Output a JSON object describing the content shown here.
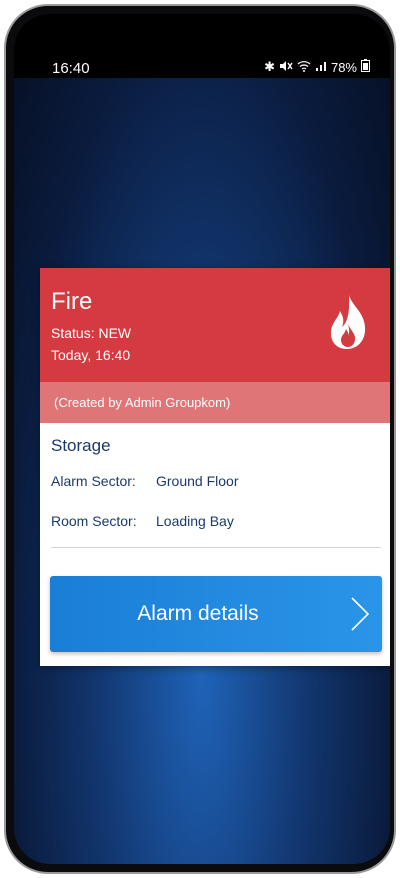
{
  "status_bar": {
    "time": "16:40",
    "icons": [
      "bluetooth-icon",
      "mute-icon",
      "wifi-icon",
      "signal-icon",
      "battery-icon"
    ],
    "battery": "78%"
  },
  "alarm": {
    "type": "Fire",
    "status": "Status: NEW",
    "time": "Today, 16:40",
    "icon": "fire-icon",
    "created_by": "(Created by Admin Groupkom)",
    "location": "Storage",
    "alarm_sector_label": "Alarm Sector:",
    "alarm_sector_value": "Ground Floor",
    "room_sector_label": "Room Sector:",
    "room_sector_value": "Loading Bay"
  },
  "details_button": {
    "label": "Alarm details",
    "icon": "chevron-right-icon"
  },
  "colors": {
    "header": "#d43b40",
    "created_bar": "#e07578",
    "button": "#2a95e8",
    "text": "#1a3a6b"
  }
}
